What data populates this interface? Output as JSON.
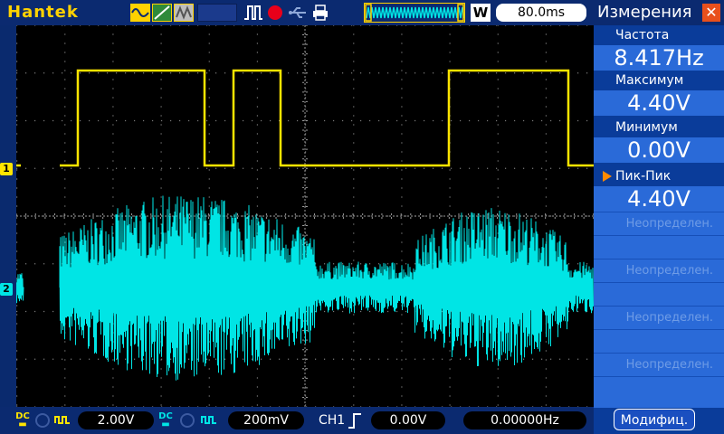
{
  "brand": "Hantek",
  "toolbar": {
    "trigger_mode": "W",
    "timebase": "80.0ms",
    "icons": [
      "sine-wave-icon",
      "ramp-icon",
      "mixed-wave-icon",
      "pulse-icon",
      "record-icon",
      "usb-icon",
      "printer-icon",
      "waveform-preview-icon"
    ]
  },
  "channels": {
    "ch1": {
      "marker": "1",
      "coupling": "DC",
      "volts_div": "2.00V",
      "color": "#ffe500"
    },
    "ch2": {
      "marker": "2",
      "coupling": "DC",
      "volts_div": "200mV",
      "color": "#00e5e5"
    }
  },
  "trigger": {
    "source": "CH1",
    "level": "0.00V",
    "frequency": "0.00000Hz"
  },
  "measurements": {
    "title": "Измерения",
    "items": [
      {
        "label": "Частота",
        "value": "8.417Hz"
      },
      {
        "label": "Максимум",
        "value": "4.40V"
      },
      {
        "label": "Минимум",
        "value": "0.00V"
      },
      {
        "label": "Пик-Пик",
        "value": "4.40V"
      }
    ],
    "undefined_label": "Неопределен.",
    "modify_button": "Модифиц."
  }
}
